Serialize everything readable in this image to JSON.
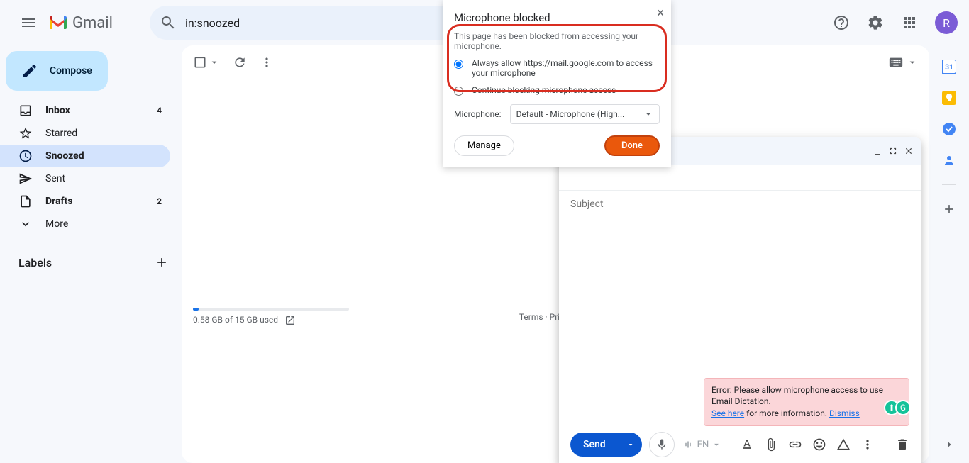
{
  "header": {
    "logo_text": "Gmail",
    "search_value": "in:snoozed",
    "avatar_letter": "R"
  },
  "sidebar": {
    "compose_label": "Compose",
    "items": [
      {
        "label": "Inbox",
        "count": "4"
      },
      {
        "label": "Starred",
        "count": ""
      },
      {
        "label": "Snoozed",
        "count": ""
      },
      {
        "label": "Sent",
        "count": ""
      },
      {
        "label": "Drafts",
        "count": "2"
      },
      {
        "label": "More",
        "count": ""
      }
    ],
    "labels_header": "Labels"
  },
  "footer": {
    "storage_text": "0.58 GB of 15 GB used",
    "links": "Terms · Privacy · Pr"
  },
  "compose": {
    "subject_placeholder": "Subject",
    "send_label": "Send",
    "lang": "EN",
    "error_prefix": "Error: Please allow microphone access to use Email Dictation.",
    "error_see": "See here",
    "error_mid": " for more information. ",
    "error_dismiss": "Dismiss"
  },
  "permission": {
    "title": "Microphone blocked",
    "desc": "This page has been blocked from accessing your microphone.",
    "opt_allow": "Always allow https://mail.google.com to access your microphone",
    "opt_block": "Continue blocking microphone access",
    "mic_label": "Microphone:",
    "mic_value": "Default - Microphone (High...",
    "manage": "Manage",
    "done": "Done"
  }
}
